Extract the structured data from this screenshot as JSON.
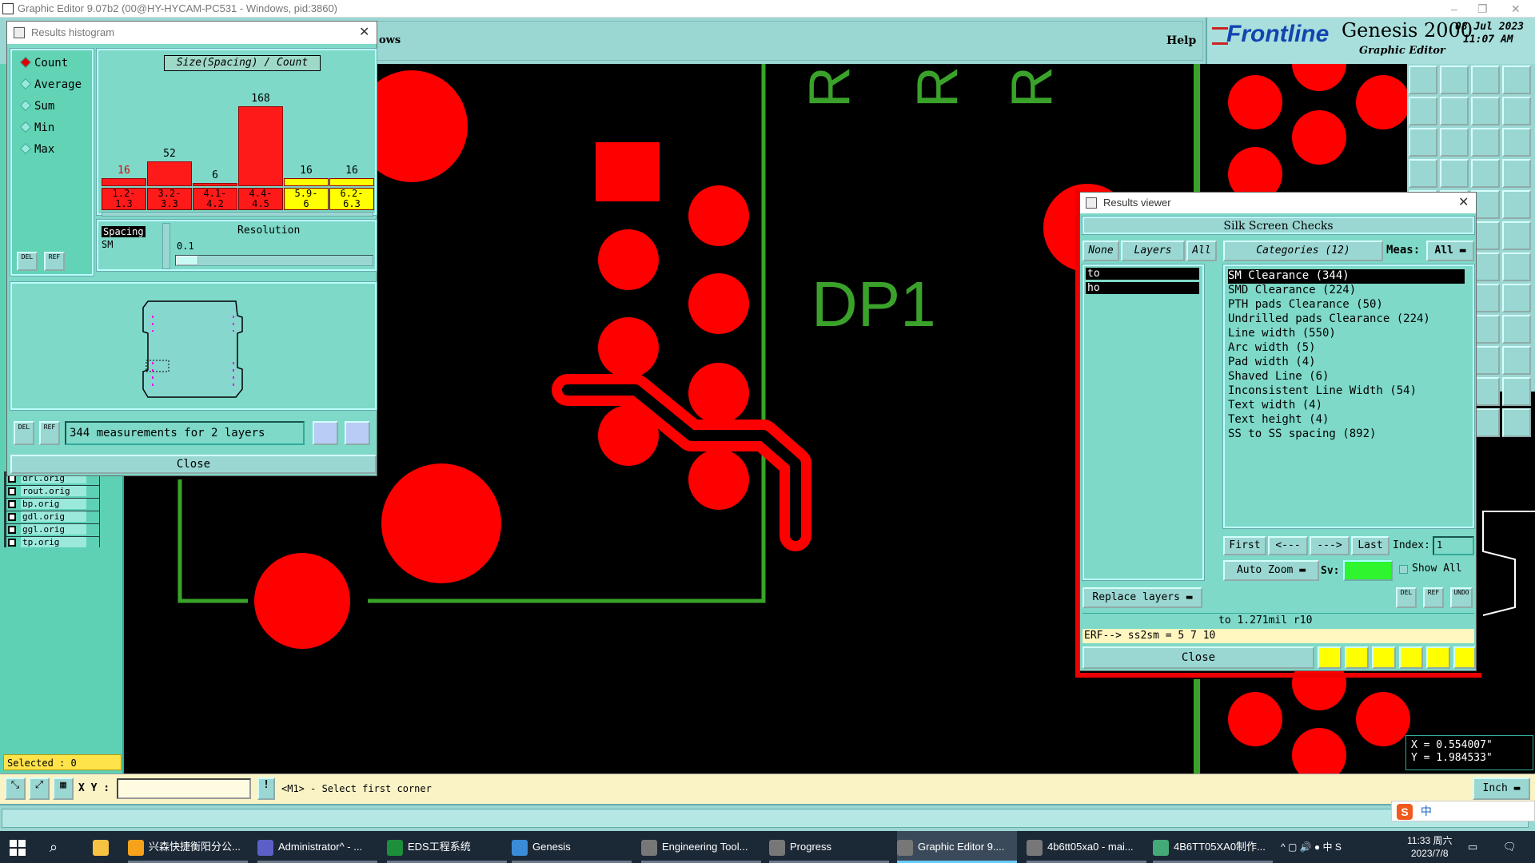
{
  "window_title": "Graphic Editor 9.07b2 (00@HY-HYCAM-PC531 - Windows, pid:3860)",
  "header": {
    "menu_partial": "ows",
    "help": "Help",
    "brand": "Frontline",
    "product": "Genesis 2000",
    "product_sub": "Graphic Editor",
    "date": "08 Jul 2023",
    "time": "11:07 AM"
  },
  "canvas": {
    "label_dp1": "DP1",
    "label_r": "R"
  },
  "histogram": {
    "title": "Results histogram",
    "radios": [
      "Count",
      "Average",
      "Sum",
      "Min",
      "Max"
    ],
    "selected": "Count",
    "chart_title": "Size(Spacing) / Count",
    "del": "DEL",
    "ref": "REF",
    "spacing_list": [
      "Spacing",
      "SM"
    ],
    "resolution_label": "Resolution",
    "resolution_value": "0.1",
    "summary": "344 measurements for 2 layers",
    "close": "Close"
  },
  "chart_data": {
    "type": "bar",
    "title": "Size(Spacing) / Count",
    "categories": [
      "1.2-1.3",
      "3.2-3.3",
      "4.1-4.2",
      "4.4-4.5",
      "5.9-6",
      "6.2-6.3"
    ],
    "cat_top": [
      "1.2-",
      "3.2-",
      "4.1-",
      "4.4-",
      "5.9-",
      "6.2-"
    ],
    "cat_bot": [
      "1.3",
      "3.3",
      "4.2",
      "4.5",
      "6",
      "6.3"
    ],
    "values": [
      16,
      52,
      6,
      168,
      16,
      16
    ],
    "colors": [
      "#ff1a1a",
      "#ff1a1a",
      "#ff1a1a",
      "#ff1a1a",
      "#ffff00",
      "#ffff00"
    ]
  },
  "layers": [
    "drl.orig",
    "rout.orig",
    "bp.orig",
    "gdl.orig",
    "ggl.orig",
    "tp.orig"
  ],
  "selected_count": "Selected : 0",
  "results_viewer": {
    "title": "Results viewer",
    "heading": "Silk Screen Checks",
    "none": "None",
    "layers": "Layers",
    "all": "All",
    "categories_btn": "Categories (12)",
    "meas_label": "Meas:",
    "meas_value": "All",
    "layer_list": [
      "to",
      "ho"
    ],
    "categories": [
      "SM Clearance (344)",
      "SMD Clearance (224)",
      "PTH pads Clearance (50)",
      "Undrilled pads Clearance (224)",
      "Line width (550)",
      "Arc width (5)",
      "Pad width (4)",
      "Shaved Line (6)",
      "Inconsistent Line Width (54)",
      "Text width (4)",
      "Text height (4)",
      "SS to SS spacing (892)"
    ],
    "first": "First",
    "prev": "<---",
    "next": "--->",
    "last": "Last",
    "index_label": "Index:",
    "index_value": "1",
    "auto_zoom": "Auto Zoom",
    "sv_label": "Sv:",
    "show_all": "Show All",
    "replace_layers": "Replace layers",
    "del": "DEL",
    "ref": "REF",
    "undo": "UNDO",
    "info_line": "to 1.271mil  r10",
    "erf_line": "ERF--> ss2sm = 5 7 10",
    "close": "Close"
  },
  "coords": {
    "x": "X = 0.554007\"",
    "y": "Y = 1.984533\""
  },
  "status": {
    "xy_label": "X Y :",
    "message": "<M1> - Select first corner",
    "units": "Inch"
  },
  "ime": {
    "lang": "中"
  },
  "taskbar": {
    "items": [
      "兴森快捷衡阳分公...",
      "Administrator^ - ...",
      "EDS工程系统",
      "Genesis",
      "Engineering Tool...",
      "Progress",
      "Graphic Editor 9....",
      "4b6tt05xa0 - mai...",
      "4B6TT05XA0制作..."
    ],
    "clock_time": "11:33 周六",
    "clock_date": "2023/7/8",
    "tray_lang": "中"
  }
}
